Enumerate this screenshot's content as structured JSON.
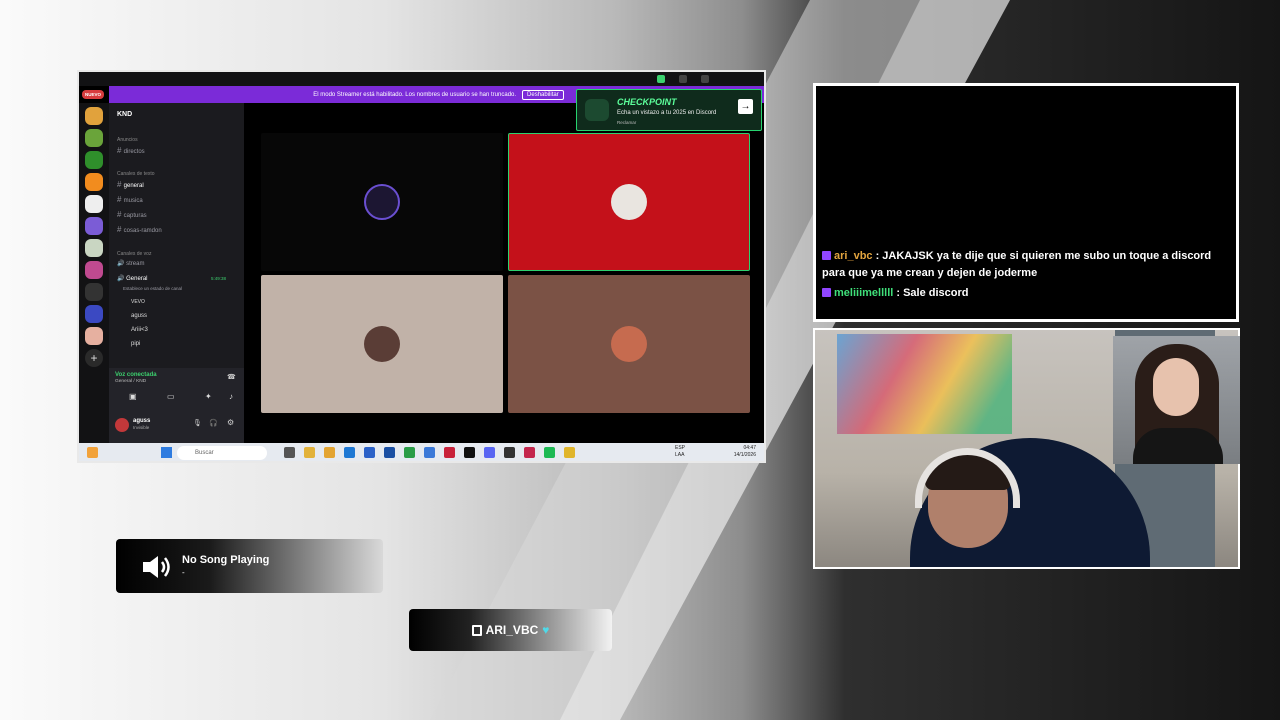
{
  "discord": {
    "new_badge": "NUEVO",
    "streamer_banner": "El modo Streamer está habilitado. Los nombres de usuario se han truncado.",
    "disable_button": "Deshabilitar",
    "server_name": "KND",
    "categories": {
      "announcements": "Anuncios",
      "text": "Canales de texto",
      "voice": "Canales de voz"
    },
    "channels": {
      "directos": "directos",
      "general": "general",
      "musica": "musica",
      "capturas": "capturas",
      "cosas": "cosas-ramdon",
      "stream": "stream",
      "voice_general": "General",
      "voice_general_time": "5:49:38",
      "status_hint": "Establece un estado de canal"
    },
    "voice_members": [
      "VEVO",
      "aguss",
      "Ariii<3",
      "pipi"
    ],
    "voice_panel": {
      "status": "Voz conectada",
      "location": "General / KND"
    },
    "user": {
      "name": "aguss",
      "status": "Invisible"
    },
    "checkpoint": {
      "title": "CHECKPOINT",
      "text": "Echa un vistazo a tu 2025 en Discord",
      "sub": "Reclamar"
    },
    "taskbar": {
      "search_placeholder": "Buscar",
      "lang": "ESP",
      "lang_sub": "LAA",
      "time": "04:47",
      "date": "14/1/2026"
    }
  },
  "chat": {
    "messages": [
      {
        "user": "ari_vbc",
        "text": " : JAKAJSK ya te dije que si quieren me subo un toque a discord para que ya me crean y dejen de joderme"
      },
      {
        "user": "meliiimelllll",
        "text": " : Sale discord"
      }
    ]
  },
  "now_playing": {
    "title": "No Song Playing",
    "subtitle": "-"
  },
  "tag": {
    "name": "ARI_VBC"
  },
  "colors": {
    "discord_purple": "#7b2bd8",
    "checkpoint_green": "#27d36f",
    "chat_user1": "#e3a53f",
    "chat_user2": "#3fe07a"
  }
}
